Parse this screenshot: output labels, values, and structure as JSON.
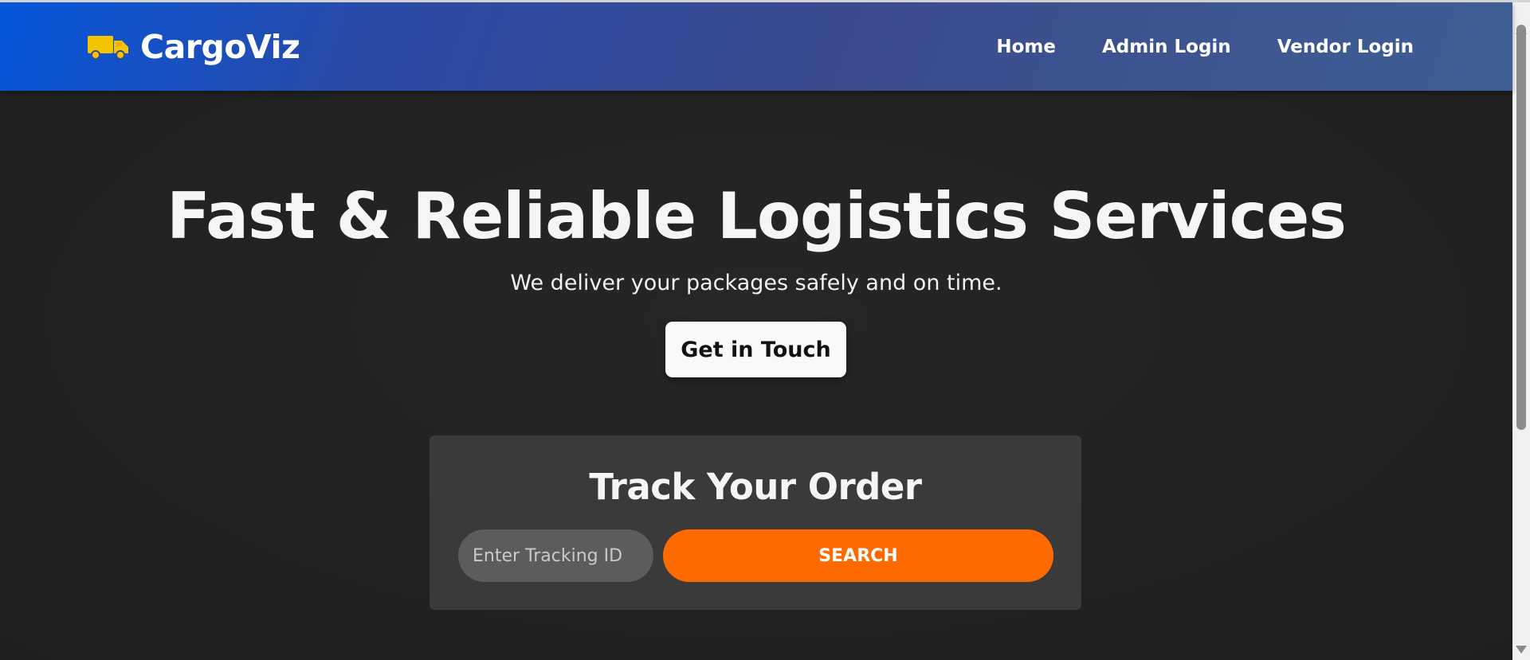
{
  "header": {
    "logo_icon": "truck-icon",
    "logo_text": "CargoViz",
    "nav": [
      {
        "label": "Home"
      },
      {
        "label": "Admin Login"
      },
      {
        "label": "Vendor Login"
      }
    ]
  },
  "hero": {
    "title": "Fast & Reliable Logistics Services",
    "subtitle": "We deliver your packages safely and on time.",
    "cta_label": "Get in Touch"
  },
  "tracking": {
    "title": "Track Your Order",
    "input_placeholder": "Enter Tracking ID",
    "input_value": "",
    "search_label": "SEARCH"
  },
  "colors": {
    "accent_orange": "#ff6a00",
    "truck_yellow": "#f5c400",
    "nav_gradient_start": "#0556db",
    "background": "#222222",
    "card": "#3a3a3a"
  }
}
